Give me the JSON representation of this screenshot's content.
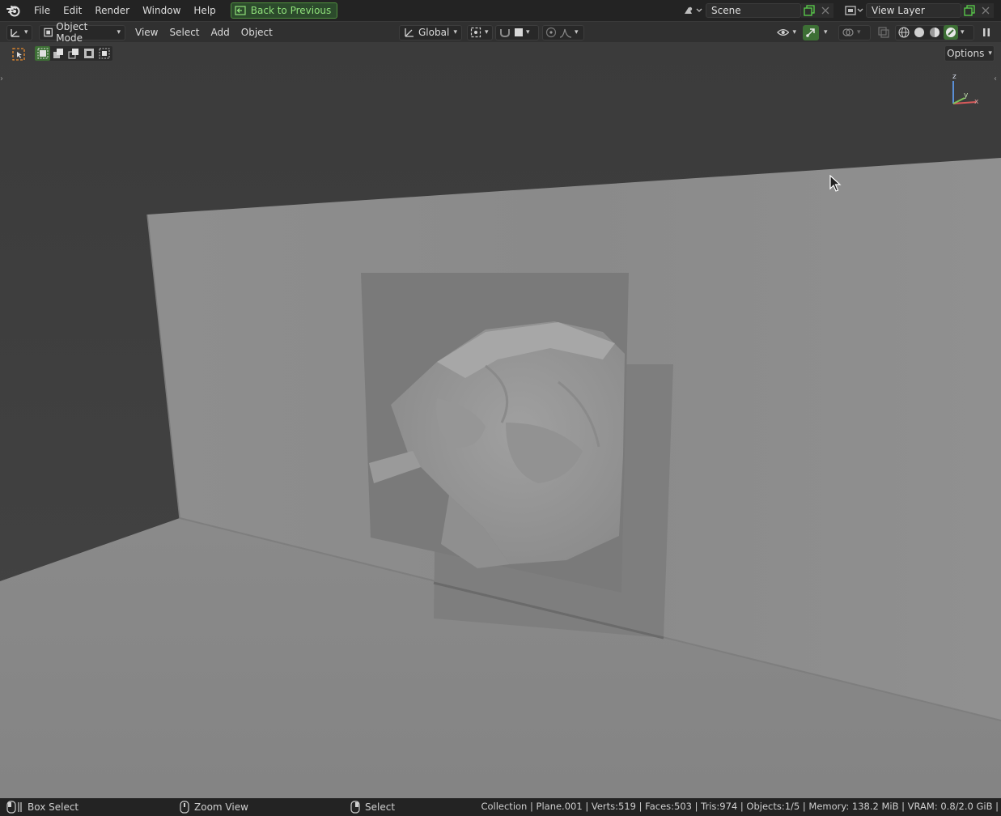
{
  "topbar": {
    "menus": [
      "File",
      "Edit",
      "Render",
      "Window",
      "Help"
    ],
    "back_button": "Back to Previous",
    "scene": "Scene",
    "view_layer": "View Layer"
  },
  "viewport_header": {
    "mode": "Object Mode",
    "menus": [
      "View",
      "Select",
      "Add",
      "Object"
    ],
    "transform_orientation": "Global"
  },
  "toolbar": {
    "options_label": "Options"
  },
  "gizmo": {
    "z": "z",
    "y": "y",
    "x": "x"
  },
  "statusbar": {
    "left_action": "Box Select",
    "middle_action": "Zoom View",
    "right_action": "Select",
    "stats": "Collection | Plane.001 | Verts:519 | Faces:503 | Tris:974 | Objects:1/5 | Memory: 138.2 MiB | VRAM: 0.8/2.0 GiB |"
  },
  "colors": {
    "accent_green": "#4f8f3f",
    "active_orange": "#e68a2e",
    "viewport_bg": "#3a3a3a"
  }
}
